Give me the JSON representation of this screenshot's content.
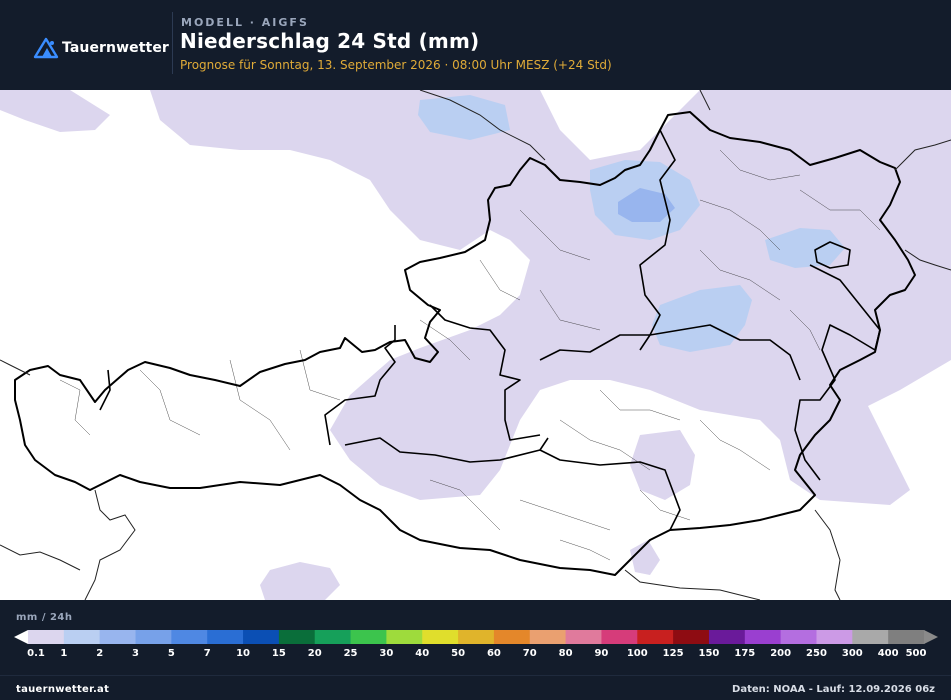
{
  "header": {
    "brand": "Tauernwetter",
    "model_line": "MODELL · AIGFS",
    "title": "Niederschlag 24 Std (mm)",
    "subtitle": "Prognose für Sonntag, 13. September 2026 · 08:00 Uhr MESZ  (+24 Std)"
  },
  "map": {
    "region": "Österreich",
    "colors": {
      "background": "#ffffff",
      "precip_light": "#dcd6ee",
      "precip_medium": "#bacff2",
      "precip_heavy": "#8fb1ec",
      "borders": "#000000"
    },
    "precip_areas": [
      {
        "class": "0.1-1",
        "description": "Nordosten, Mühlviertel bis Weinviertel"
      },
      {
        "class": "1-2",
        "description": "Oberösterreich, Waldviertel, Mostviertel"
      },
      {
        "class": "2-3",
        "description": "Mühlviertel"
      }
    ]
  },
  "legend": {
    "unit": "mm / 24h",
    "ticks": [
      "0.1",
      "1",
      "2",
      "3",
      "5",
      "7",
      "10",
      "15",
      "20",
      "25",
      "30",
      "40",
      "50",
      "60",
      "70",
      "80",
      "90",
      "100",
      "125",
      "150",
      "175",
      "200",
      "250",
      "300",
      "400",
      "500"
    ],
    "colors": [
      "#dcd6ee",
      "#bacff2",
      "#98b5ee",
      "#77a1e9",
      "#4f88e3",
      "#2a6ed4",
      "#0b4fb4",
      "#0a6e3a",
      "#16a05a",
      "#3cc44d",
      "#9edb3c",
      "#e0de2c",
      "#e0b42b",
      "#e4872a",
      "#eaa070",
      "#e07a9c",
      "#d63c7a",
      "#c8201f",
      "#8e0c12",
      "#6a1a9a",
      "#9a3fd0",
      "#b46ee0",
      "#cc9ae6",
      "#a9a9a9",
      "#7f7f7f"
    ]
  },
  "footer": {
    "site": "tauernwetter.at",
    "credits": "Daten: NOAA - Lauf: 12.09.2026 06z"
  }
}
